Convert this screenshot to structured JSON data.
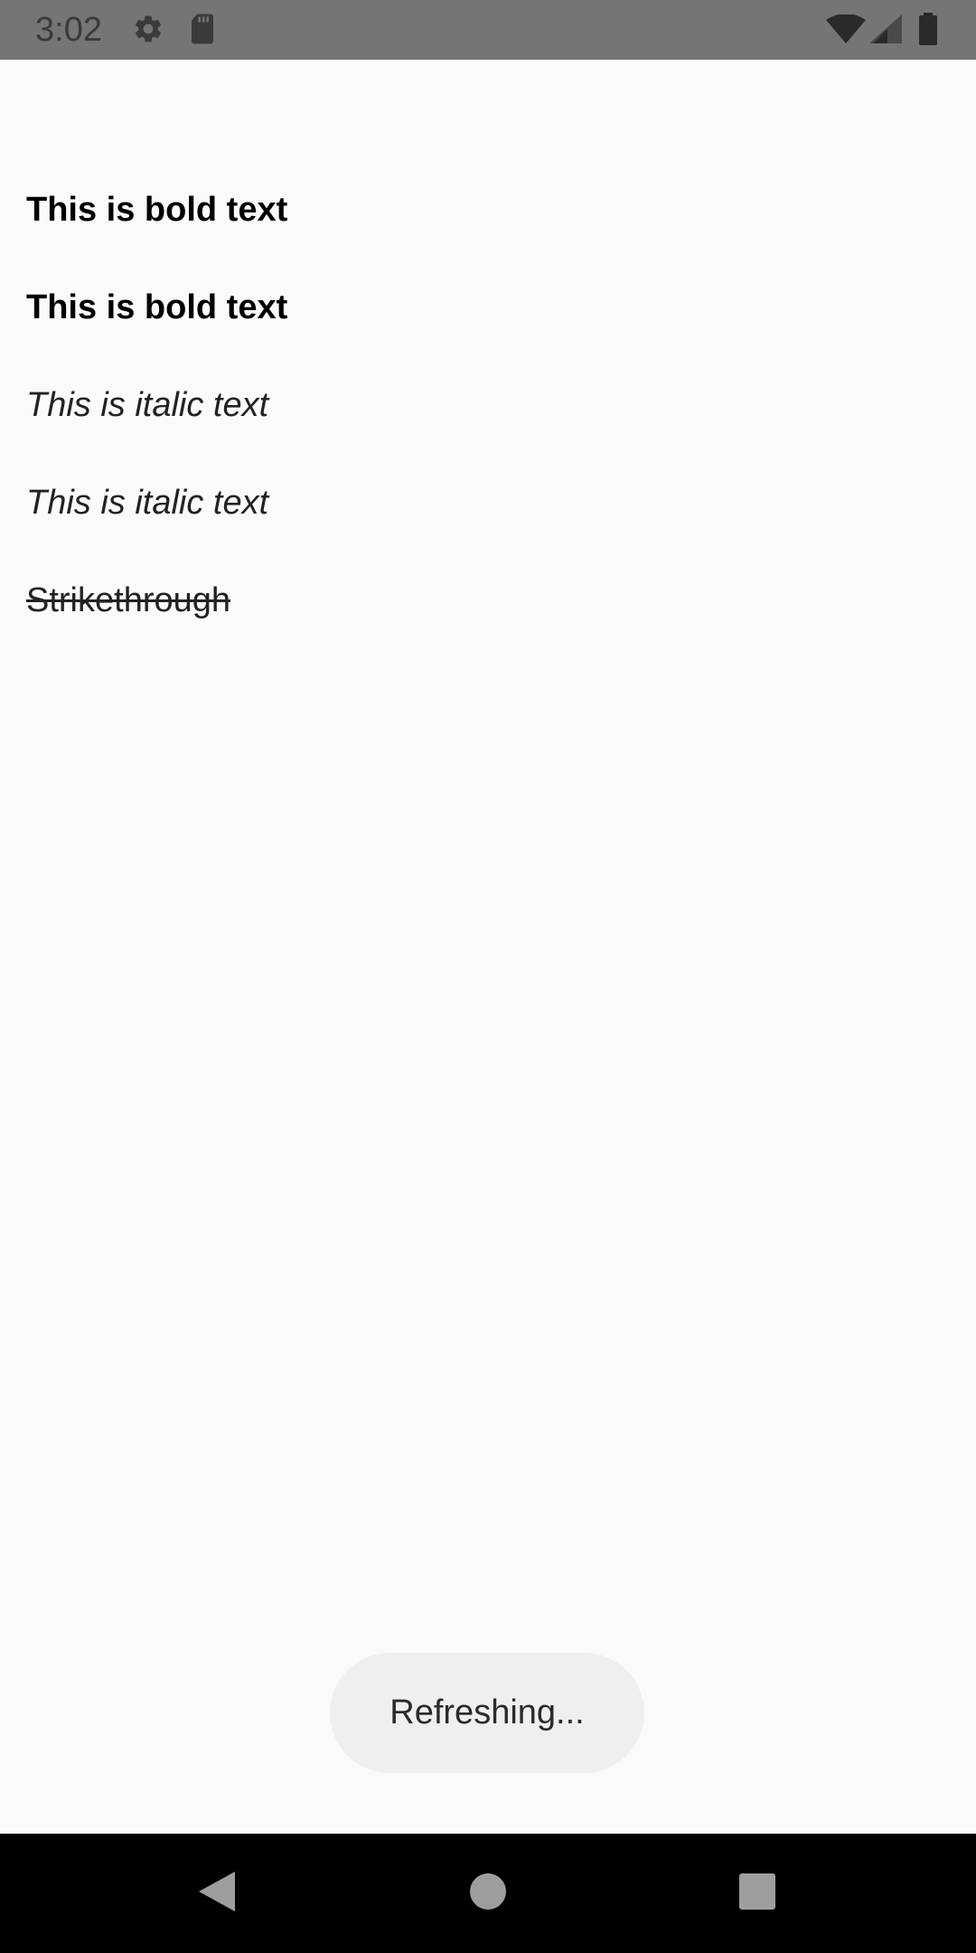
{
  "status_bar": {
    "time": "3:02",
    "icons": [
      "settings-icon",
      "sd-card-icon",
      "wifi-icon",
      "signal-icon",
      "battery-icon"
    ]
  },
  "content": {
    "lines": [
      {
        "text": "This is bold text",
        "style": "bold"
      },
      {
        "text": "This is bold text",
        "style": "bold"
      },
      {
        "text": "This is italic text",
        "style": "italic"
      },
      {
        "text": "This is italic text",
        "style": "italic"
      },
      {
        "text": "Strikethrough",
        "style": "strikethrough"
      }
    ]
  },
  "toast": {
    "text": "Refreshing..."
  },
  "nav_bar": {
    "buttons": [
      "back-icon",
      "home-icon",
      "recents-icon"
    ]
  }
}
